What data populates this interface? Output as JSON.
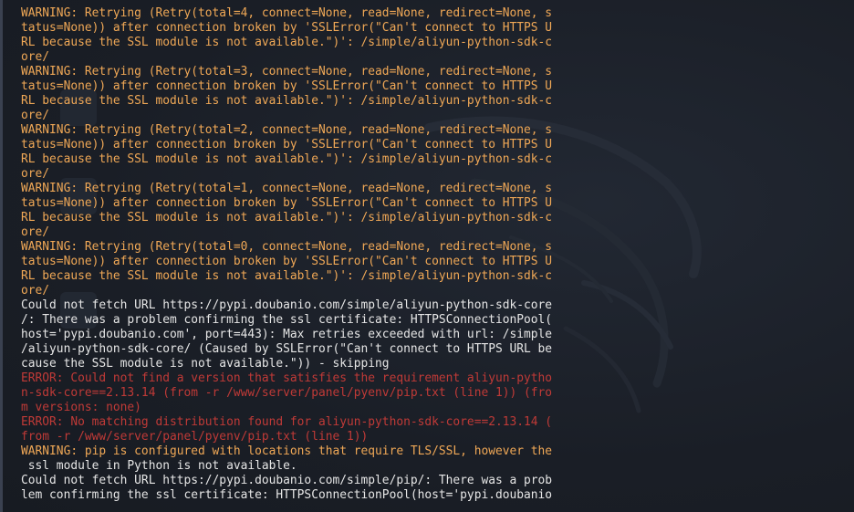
{
  "terminal": {
    "lines": [
      {
        "text": "",
        "kind": "normal"
      },
      {
        "text": "WARNING: Retrying (Retry(total=4, connect=None, read=None, redirect=None, s",
        "kind": "warn"
      },
      {
        "text": "tatus=None)) after connection broken by 'SSLError(\"Can't connect to HTTPS U",
        "kind": "warn"
      },
      {
        "text": "RL because the SSL module is not available.\")': /simple/aliyun-python-sdk-c",
        "kind": "warn"
      },
      {
        "text": "ore/",
        "kind": "warn"
      },
      {
        "text": "WARNING: Retrying (Retry(total=3, connect=None, read=None, redirect=None, s",
        "kind": "warn"
      },
      {
        "text": "tatus=None)) after connection broken by 'SSLError(\"Can't connect to HTTPS U",
        "kind": "warn"
      },
      {
        "text": "RL because the SSL module is not available.\")': /simple/aliyun-python-sdk-c",
        "kind": "warn"
      },
      {
        "text": "ore/",
        "kind": "warn"
      },
      {
        "text": "WARNING: Retrying (Retry(total=2, connect=None, read=None, redirect=None, s",
        "kind": "warn"
      },
      {
        "text": "tatus=None)) after connection broken by 'SSLError(\"Can't connect to HTTPS U",
        "kind": "warn"
      },
      {
        "text": "RL because the SSL module is not available.\")': /simple/aliyun-python-sdk-c",
        "kind": "warn"
      },
      {
        "text": "ore/",
        "kind": "warn"
      },
      {
        "text": "WARNING: Retrying (Retry(total=1, connect=None, read=None, redirect=None, s",
        "kind": "warn"
      },
      {
        "text": "tatus=None)) after connection broken by 'SSLError(\"Can't connect to HTTPS U",
        "kind": "warn"
      },
      {
        "text": "RL because the SSL module is not available.\")': /simple/aliyun-python-sdk-c",
        "kind": "warn"
      },
      {
        "text": "ore/",
        "kind": "warn"
      },
      {
        "text": "WARNING: Retrying (Retry(total=0, connect=None, read=None, redirect=None, s",
        "kind": "warn"
      },
      {
        "text": "tatus=None)) after connection broken by 'SSLError(\"Can't connect to HTTPS U",
        "kind": "warn"
      },
      {
        "text": "RL because the SSL module is not available.\")': /simple/aliyun-python-sdk-c",
        "kind": "warn"
      },
      {
        "text": "ore/",
        "kind": "warn"
      },
      {
        "text": "Could not fetch URL https://pypi.doubanio.com/simple/aliyun-python-sdk-core",
        "kind": "normal"
      },
      {
        "text": "/: There was a problem confirming the ssl certificate: HTTPSConnectionPool(",
        "kind": "normal"
      },
      {
        "text": "host='pypi.doubanio.com', port=443): Max retries exceeded with url: /simple",
        "kind": "normal"
      },
      {
        "text": "/aliyun-python-sdk-core/ (Caused by SSLError(\"Can't connect to HTTPS URL be",
        "kind": "normal"
      },
      {
        "text": "cause the SSL module is not available.\")) - skipping",
        "kind": "normal"
      },
      {
        "text": "ERROR: Could not find a version that satisfies the requirement aliyun-pytho",
        "kind": "error"
      },
      {
        "text": "n-sdk-core==2.13.14 (from -r /www/server/panel/pyenv/pip.txt (line 1)) (fro",
        "kind": "error"
      },
      {
        "text": "m versions: none)",
        "kind": "error"
      },
      {
        "text": "ERROR: No matching distribution found for aliyun-python-sdk-core==2.13.14 (",
        "kind": "error"
      },
      {
        "text": "from -r /www/server/panel/pyenv/pip.txt (line 1))",
        "kind": "error"
      },
      {
        "text": "WARNING: pip is configured with locations that require TLS/SSL, however the",
        "kind": "warn"
      },
      {
        "text": " ssl module in Python is not available.",
        "kind": "normal"
      },
      {
        "text": "Could not fetch URL https://pypi.doubanio.com/simple/pip/: There was a prob",
        "kind": "normal"
      },
      {
        "text": "lem confirming the ssl certificate: HTTPSConnectionPool(host='pypi.doubanio",
        "kind": "normal"
      }
    ]
  },
  "colors": {
    "warning": "#f0a856",
    "error": "#c03a37",
    "normal": "#e6e6e6",
    "background": "#1b1f27"
  }
}
